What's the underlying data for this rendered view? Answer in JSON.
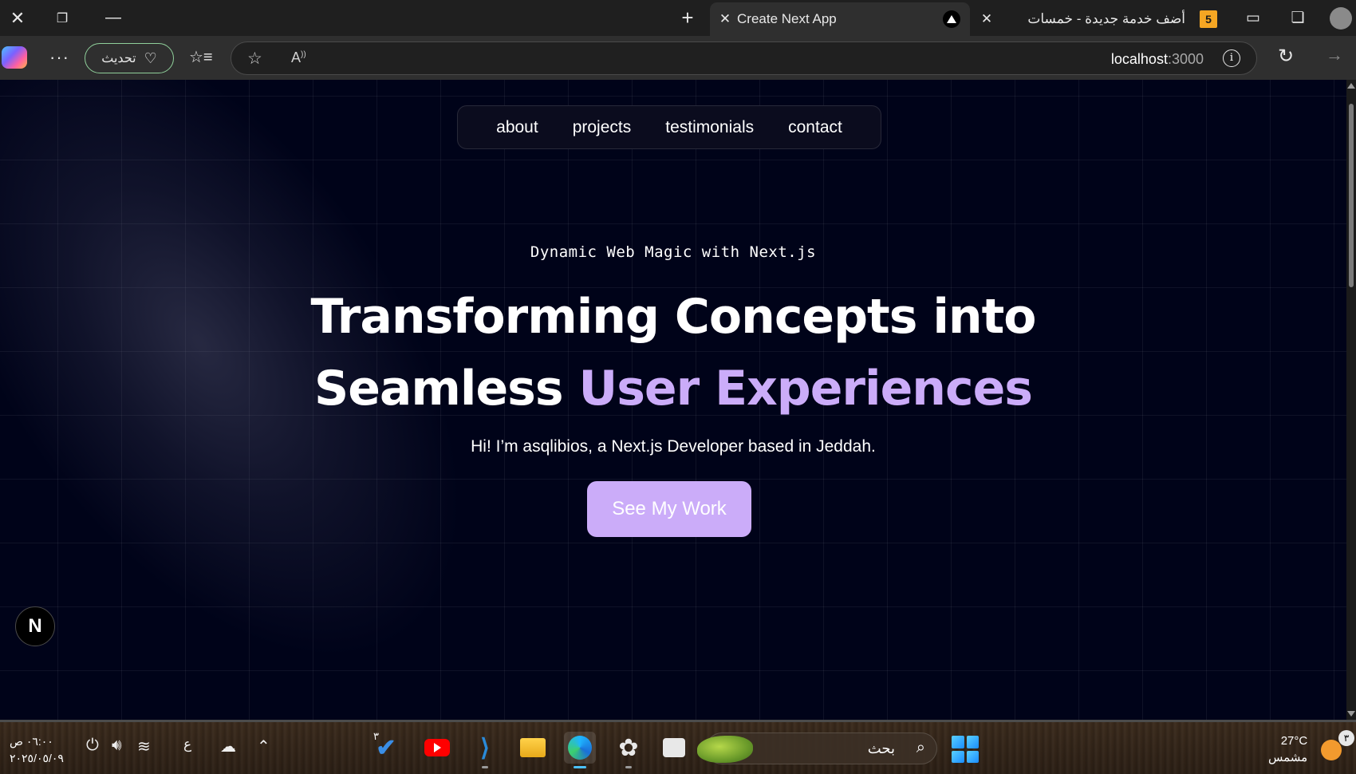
{
  "browser": {
    "tabs": [
      {
        "title": "Create Next App",
        "favicon": "vercel-triangle-icon",
        "active": true
      },
      {
        "title": "أضف خدمة جديدة - خمسات",
        "favicon_text": "5",
        "active": false
      }
    ],
    "update_button_label": "تحديث",
    "url": {
      "host": "localhost",
      "port": ":3000"
    }
  },
  "page": {
    "nav_links": [
      "about",
      "projects",
      "testimonials",
      "contact"
    ],
    "eyebrow": "Dynamic Web Magic with Next.js",
    "headline_line1": "Transforming Concepts into",
    "headline_line2_plain": "Seamless ",
    "headline_line2_accent": "User Experiences",
    "intro": "Hi! I’m asqlibios, a Next.js Developer based in Jeddah.",
    "cta_label": "See My Work",
    "next_badge": "N",
    "colors": {
      "background": "#000319",
      "accent": "#cbacf9"
    }
  },
  "taskbar": {
    "time": "٠٦:٠٠ ص",
    "date": "٢٠٢٥/٠٥/٠٩",
    "input_language": "ع",
    "search_label": "بحث",
    "weather_temp": "27°C",
    "weather_desc": "مشمس",
    "notification_count": "٣",
    "todo_badge": "٣"
  }
}
